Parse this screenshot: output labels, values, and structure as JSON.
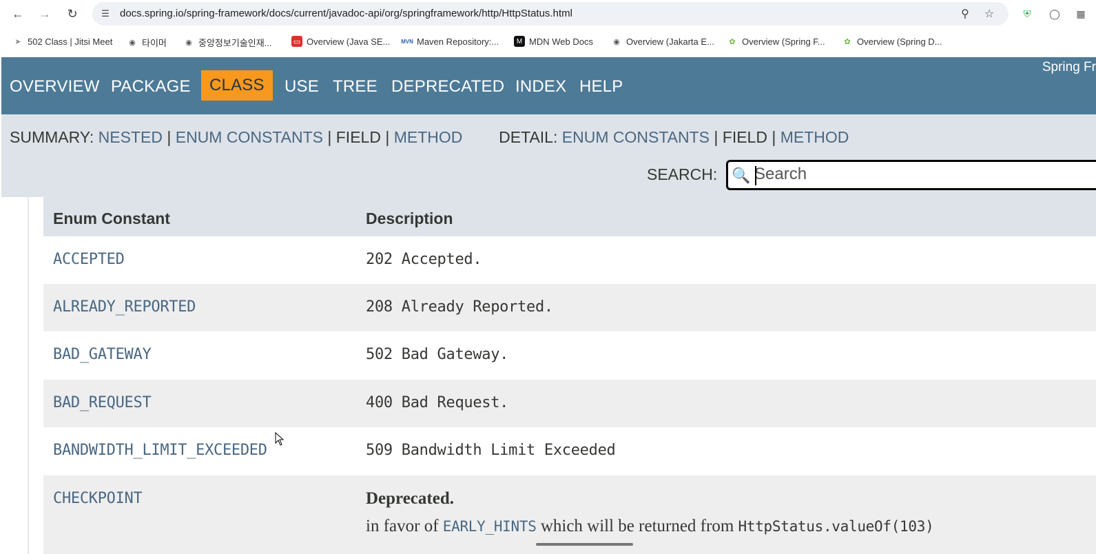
{
  "browser": {
    "url": "docs.spring.io/spring-framework/docs/current/javadoc-api/org/springframework/http/HttpStatus.html",
    "bookmarks": [
      {
        "label": "502 Class | Jitsi Meet",
        "icon": "jitsi-icon"
      },
      {
        "label": "타이머",
        "icon": "globe-icon"
      },
      {
        "label": "중앙정보기술인재...",
        "icon": "globe-icon"
      },
      {
        "label": "Overview (Java SE...",
        "icon": "oracle-icon"
      },
      {
        "label": "Maven Repository:...",
        "icon": "mvn-icon"
      },
      {
        "label": "MDN Web Docs",
        "icon": "mdn-icon"
      },
      {
        "label": "Overview (Jakarta E...",
        "icon": "globe-icon"
      },
      {
        "label": "Overview (Spring F...",
        "icon": "spring-icon"
      },
      {
        "label": "Overview (Spring D...",
        "icon": "spring-icon"
      }
    ]
  },
  "header": {
    "nav": [
      "OVERVIEW",
      "PACKAGE",
      "CLASS",
      "USE",
      "TREE",
      "DEPRECATED",
      "INDEX",
      "HELP"
    ],
    "active": "CLASS",
    "about": "Spring Fr"
  },
  "subnav": {
    "summary_label": "SUMMARY:",
    "summary_nested": "NESTED",
    "summary_enum": "ENUM CONSTANTS",
    "summary_field": "FIELD",
    "summary_method": "METHOD",
    "detail_label": "DETAIL:",
    "detail_enum": "ENUM CONSTANTS",
    "detail_field": "FIELD",
    "detail_method": "METHOD",
    "sep": "|",
    "search_label": "SEARCH:",
    "search_placeholder": "Search"
  },
  "table": {
    "col_name": "Enum Constant",
    "col_desc": "Description",
    "rows": [
      {
        "name": "ACCEPTED",
        "desc": "202 Accepted."
      },
      {
        "name": "ALREADY_REPORTED",
        "desc": "208 Already Reported."
      },
      {
        "name": "BAD_GATEWAY",
        "desc": "502 Bad Gateway."
      },
      {
        "name": "BAD_REQUEST",
        "desc": "400 Bad Request."
      },
      {
        "name": "BANDWIDTH_LIMIT_EXCEEDED",
        "desc": "509 Bandwidth Limit Exceeded"
      },
      {
        "name": "CHECKPOINT",
        "desc": ""
      }
    ],
    "deprecated": {
      "title": "Deprecated.",
      "prefix": "in favor of ",
      "link": "EARLY_HINTS",
      "middle": " which will be returned from ",
      "code": "HttpStatus.valueOf(103)"
    }
  },
  "colors": {
    "nav_bg": "#4d7a97",
    "nav_active": "#f8981d",
    "subnav_bg": "#dee3e9",
    "link": "#4a6782",
    "row_alt": "#eeeeef"
  }
}
